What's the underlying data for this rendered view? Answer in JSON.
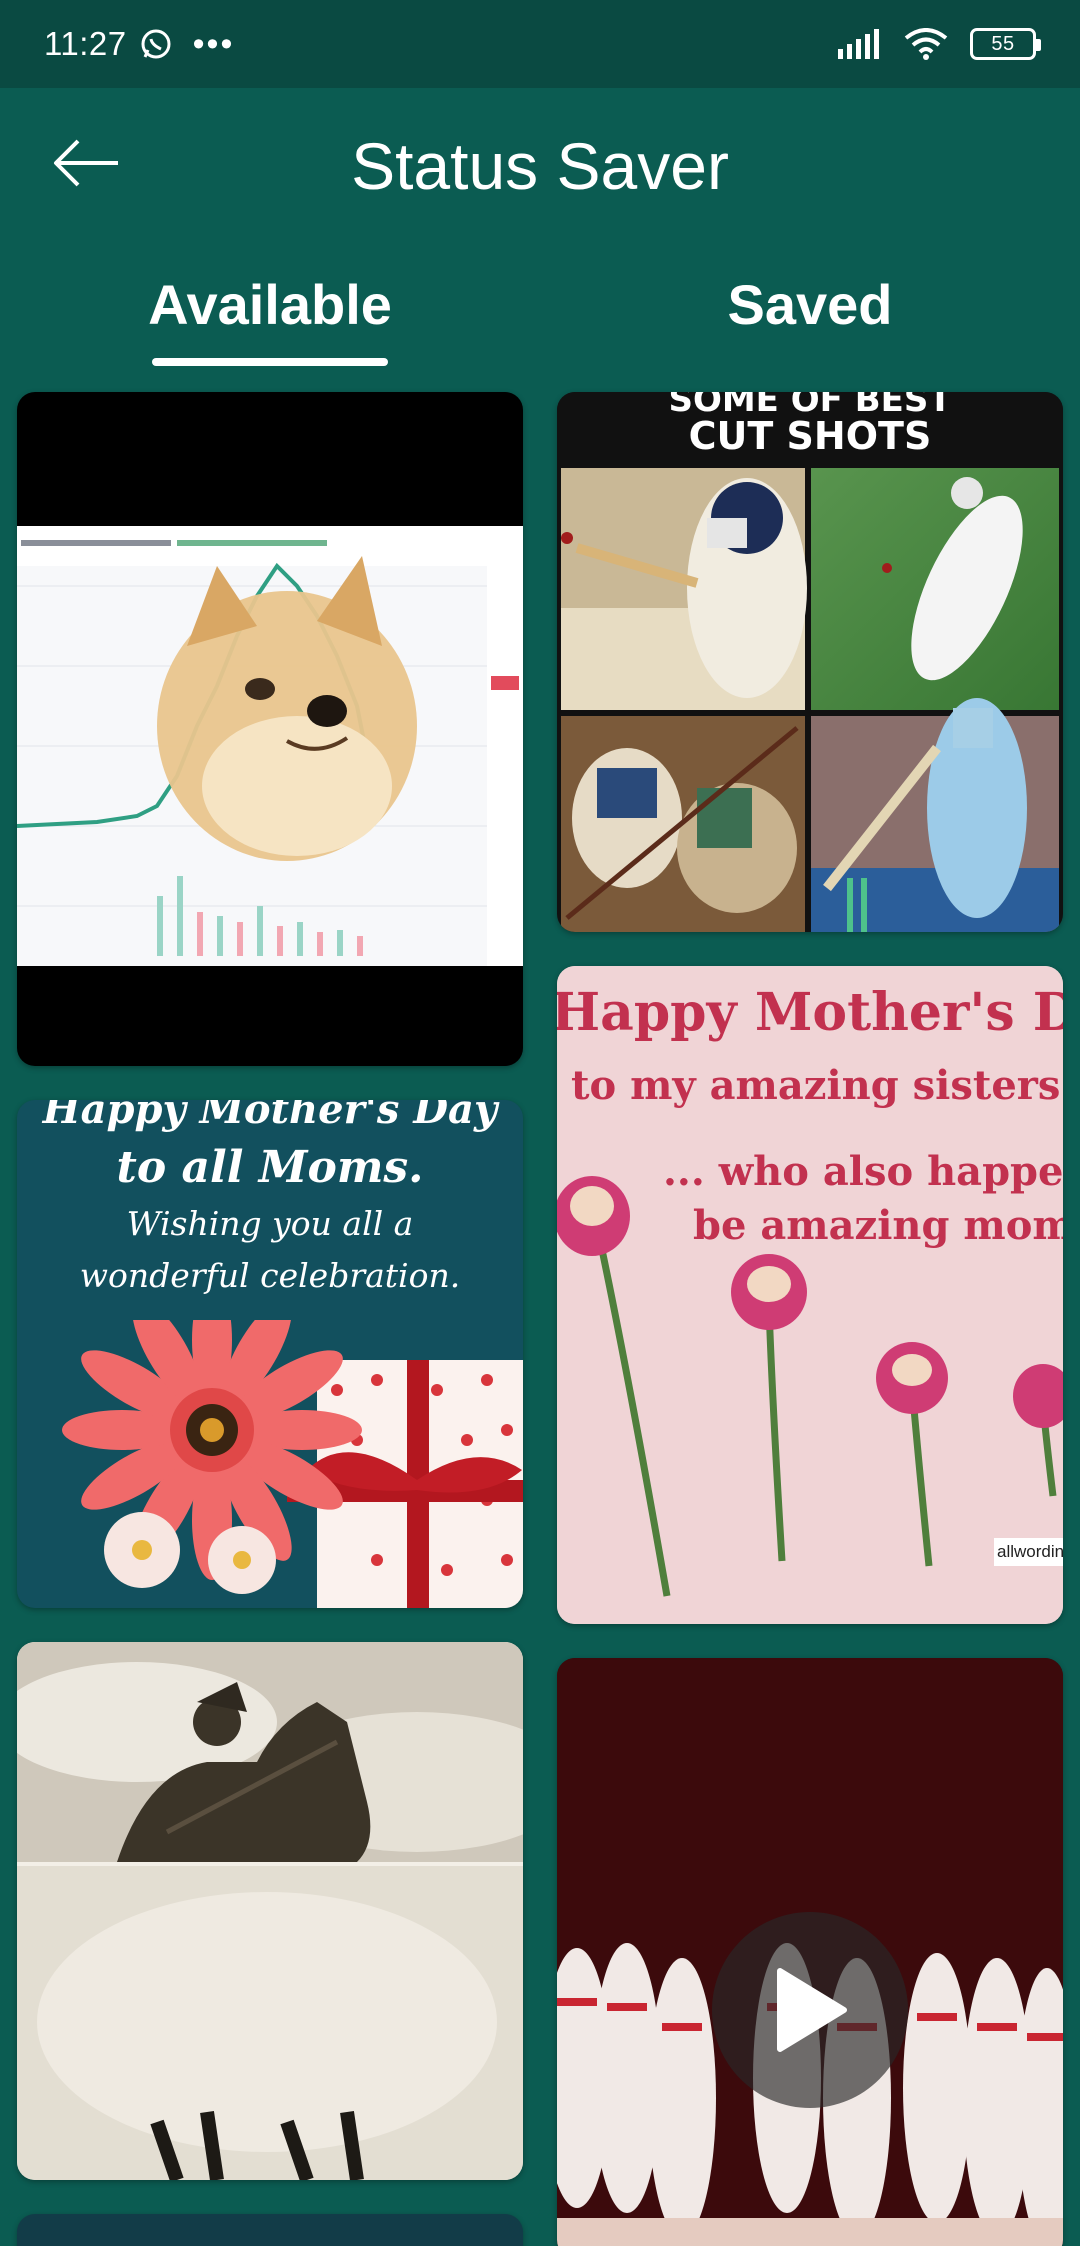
{
  "status_bar": {
    "time": "11:27",
    "dots": "•••",
    "battery": "55"
  },
  "app_bar": {
    "title": "Status Saver",
    "back_icon": "arrow-left-icon"
  },
  "tabs": [
    {
      "label": "Available",
      "selected": true
    },
    {
      "label": "Saved",
      "selected": false
    }
  ],
  "cards": {
    "cricket": {
      "line1": "SOME OF BEST",
      "line2": "CUT SHOTS"
    },
    "mothers_blue": {
      "line1": "Happy Mother's Day",
      "line2": "to all Moms.",
      "line3": "Wishing you all a",
      "line4": "wonderful celebration."
    },
    "mothers_pink": {
      "line1": "Happy Mother's Da",
      "line2": "to my amazing sisters",
      "line3": "... who also happen",
      "line4": "be amazing moms",
      "watermark": "allwordin"
    },
    "video": {
      "play_icon": "play-icon"
    }
  },
  "colors": {
    "background": "#0b5c52",
    "status_bar": "#0a4a42",
    "accent": "#ffffff"
  }
}
